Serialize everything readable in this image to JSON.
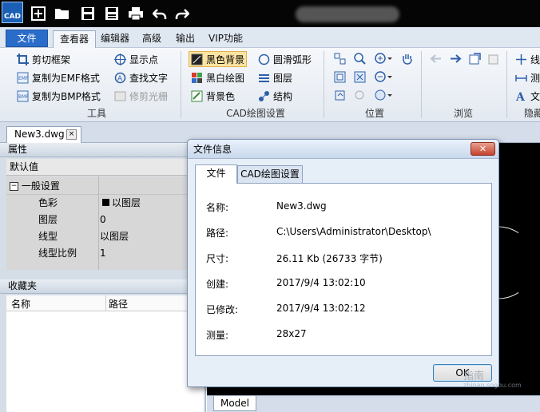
{
  "app": {
    "logo_text": "CAD"
  },
  "menu": {
    "file": "文件",
    "tabs": [
      "查看器",
      "编辑器",
      "高级",
      "输出",
      "VIP功能"
    ],
    "active_tab": "查看器"
  },
  "ribbon": {
    "tools_group": {
      "label": "工具",
      "items": [
        "剪切框架",
        "复制为EMF格式",
        "复制为BMP格式",
        "显示点",
        "查找文字",
        "修剪光栅"
      ]
    },
    "cad_settings_group": {
      "label": "CAD绘图设置",
      "items": [
        "黑色背景",
        "黑白绘图",
        "背景色",
        "圆滑弧形",
        "图层",
        "结构"
      ]
    },
    "position_group": {
      "label": "位置"
    },
    "browse_group": {
      "label": "浏览"
    },
    "hidden_group": {
      "label": "隐藏",
      "items": [
        "线",
        "测",
        "文"
      ]
    }
  },
  "document": {
    "tab_label": "New3.dwg",
    "close_glyph": "×"
  },
  "properties_panel": {
    "title": "属性",
    "default_row": "默认值",
    "section": "一般设置",
    "rows": [
      {
        "name": "色彩",
        "value": "以图层"
      },
      {
        "name": "图层",
        "value": "0"
      },
      {
        "name": "线型",
        "value": "以图层"
      },
      {
        "name": "线型比例",
        "value": "1"
      }
    ]
  },
  "favorites_panel": {
    "title": "收藏夹",
    "pin": "ᵰ",
    "columns": [
      "名称",
      "路径"
    ]
  },
  "model_tab": "Model",
  "dialog": {
    "title": "文件信息",
    "close_glyph": "✕",
    "tabs": [
      "文件",
      "CAD绘图设置"
    ],
    "fields": [
      {
        "label": "名称:",
        "value": "New3.dwg"
      },
      {
        "label": "路径:",
        "value": "C:\\Users\\Administrator\\Desktop\\"
      },
      {
        "label": "尺寸:",
        "value": "26.11 Kb (26733 字节)"
      },
      {
        "label": "创建:",
        "value": "2017/9/4 13:02:10"
      },
      {
        "label": "已修改:",
        "value": "2017/9/4 13:02:12"
      },
      {
        "label": "测量:",
        "value": "28x27"
      }
    ],
    "ok_label": "OK"
  },
  "watermark": {
    "line1": "指南",
    "line2": "zhinan.sogou.com"
  }
}
